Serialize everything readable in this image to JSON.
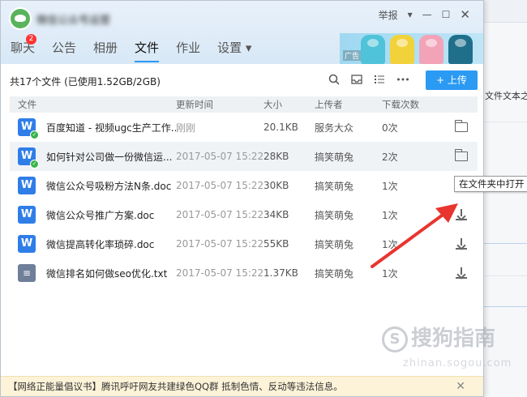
{
  "window": {
    "group_name": "微信公众号运营",
    "report_label": "举报",
    "dropdown_glyph": "▾",
    "minimize_glyph": "—",
    "maximize_glyph": "☐",
    "close_glyph": "✕"
  },
  "nav": {
    "tabs": [
      {
        "label": "聊天",
        "badge": "2"
      },
      {
        "label": "公告"
      },
      {
        "label": "相册"
      },
      {
        "label": "文件",
        "active": true
      },
      {
        "label": "作业"
      },
      {
        "label": "设置 ▾"
      }
    ]
  },
  "banner": {
    "ad_label": "广告",
    "jacket_colors": [
      "#4fc3d9",
      "#f2d23a",
      "#f3a3b8",
      "#1f6f8b"
    ]
  },
  "toolbar": {
    "summary": "共17个文件 (已使用1.52GB/2GB)",
    "upload_label": "+ 上传",
    "icons": [
      "search-icon",
      "inbox-icon",
      "list-icon",
      "more-icon"
    ]
  },
  "table": {
    "headers": {
      "name": "文件",
      "time": "更新时间",
      "size": "大小",
      "uploader": "上传者",
      "downloads": "下载次数"
    },
    "rows": [
      {
        "icon": "W",
        "type": "doc",
        "downloaded": true,
        "name": "百度知道 - 视频ugc生产工作...",
        "time": "刚刚",
        "size": "20.1KB",
        "uploader": "服务大众",
        "downloads": "0次",
        "action": "open-folder"
      },
      {
        "icon": "W",
        "type": "doc",
        "downloaded": true,
        "hover": true,
        "name": "如何针对公司做一份微信运...",
        "time": "2017-05-07 15:22",
        "size": "28KB",
        "uploader": "搞笑萌兔",
        "downloads": "2次",
        "action": "open-folder"
      },
      {
        "icon": "W",
        "type": "doc",
        "downloaded": false,
        "name": "微信公众号吸粉方法N条.doc",
        "time": "2017-05-07 15:22",
        "size": "30KB",
        "uploader": "搞笑萌兔",
        "downloads": "1次",
        "action": "download"
      },
      {
        "icon": "W",
        "type": "doc",
        "downloaded": false,
        "name": "微信公众号推广方案.doc",
        "time": "2017-05-07 15:22",
        "size": "34KB",
        "uploader": "搞笑萌兔",
        "downloads": "1次",
        "action": "download"
      },
      {
        "icon": "W",
        "type": "doc",
        "downloaded": false,
        "name": "微信提高转化率琐碎.doc",
        "time": "2017-05-07 15:22",
        "size": "55KB",
        "uploader": "搞笑萌兔",
        "downloads": "1次",
        "action": "download"
      },
      {
        "icon": "≡",
        "type": "txt",
        "downloaded": false,
        "name": "微信排名如何做seo优化.txt",
        "time": "2017-05-07 15:22",
        "size": "1.37KB",
        "uploader": "搞笑萌兔",
        "downloads": "1次",
        "action": "download"
      }
    ]
  },
  "tooltip": "在文件夹中打开",
  "watermark": {
    "main": "搜狗指南",
    "circle": "S",
    "sub": "zhinan.sogou.com"
  },
  "notice": {
    "text": "【网络正能量倡议书】腾讯呼吁网友共建绿色QQ群 抵制色情、反动等违法信息。",
    "close_glyph": "✕"
  },
  "background_window": {
    "snippet": "文件文本之美"
  },
  "colors": {
    "accent": "#2b9af3",
    "arrow": "#e8352f",
    "doc_icon": "#2f7ee8",
    "txt_icon": "#6f7f99",
    "check": "#37b34a"
  }
}
